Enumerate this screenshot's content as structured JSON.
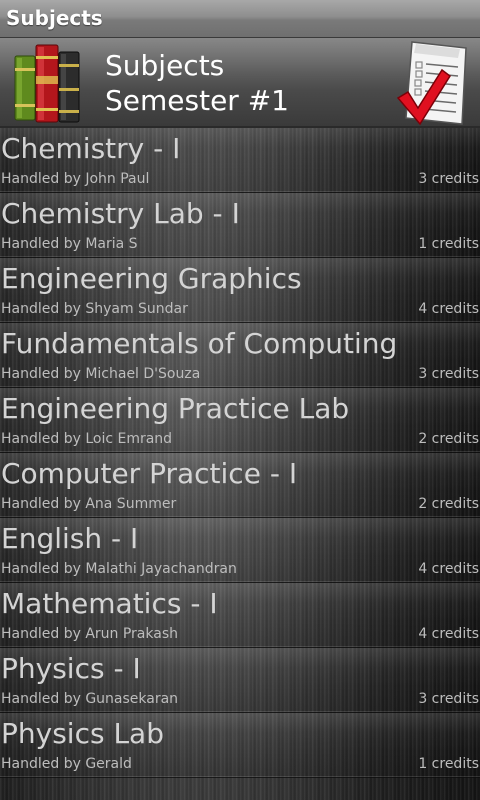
{
  "window": {
    "title": "Subjects"
  },
  "header": {
    "title": "Subjects",
    "subtitle": "Semester #1",
    "left_icon": "books-icon",
    "right_icon": "checklist-icon"
  },
  "subjects": [
    {
      "name": "Chemistry - I",
      "teacher": "Handled by John Paul",
      "credits": "3 credits"
    },
    {
      "name": "Chemistry Lab - I",
      "teacher": "Handled by Maria S",
      "credits": "1 credits"
    },
    {
      "name": "Engineering Graphics",
      "teacher": "Handled by Shyam Sundar",
      "credits": "4 credits"
    },
    {
      "name": "Fundamentals of Computing",
      "teacher": "Handled by Michael D'Souza",
      "credits": "3 credits"
    },
    {
      "name": "Engineering Practice Lab",
      "teacher": "Handled by Loic Emrand",
      "credits": "2 credits"
    },
    {
      "name": "Computer Practice - I",
      "teacher": "Handled by Ana Summer",
      "credits": "2 credits"
    },
    {
      "name": "English - I",
      "teacher": "Handled by Malathi Jayachandran",
      "credits": "4 credits"
    },
    {
      "name": "Mathematics - I",
      "teacher": "Handled by Arun Prakash",
      "credits": "4 credits"
    },
    {
      "name": "Physics - I",
      "teacher": "Handled by Gunasekaran",
      "credits": "3 credits"
    },
    {
      "name": "Physics Lab",
      "teacher": "Handled by Gerald",
      "credits": "1 credits"
    }
  ],
  "colors": {
    "titlebar": "#8e8e8e",
    "text_primary": "#d4d4d4",
    "text_secondary": "#bdbdbd",
    "checkmark": "#e01020"
  }
}
